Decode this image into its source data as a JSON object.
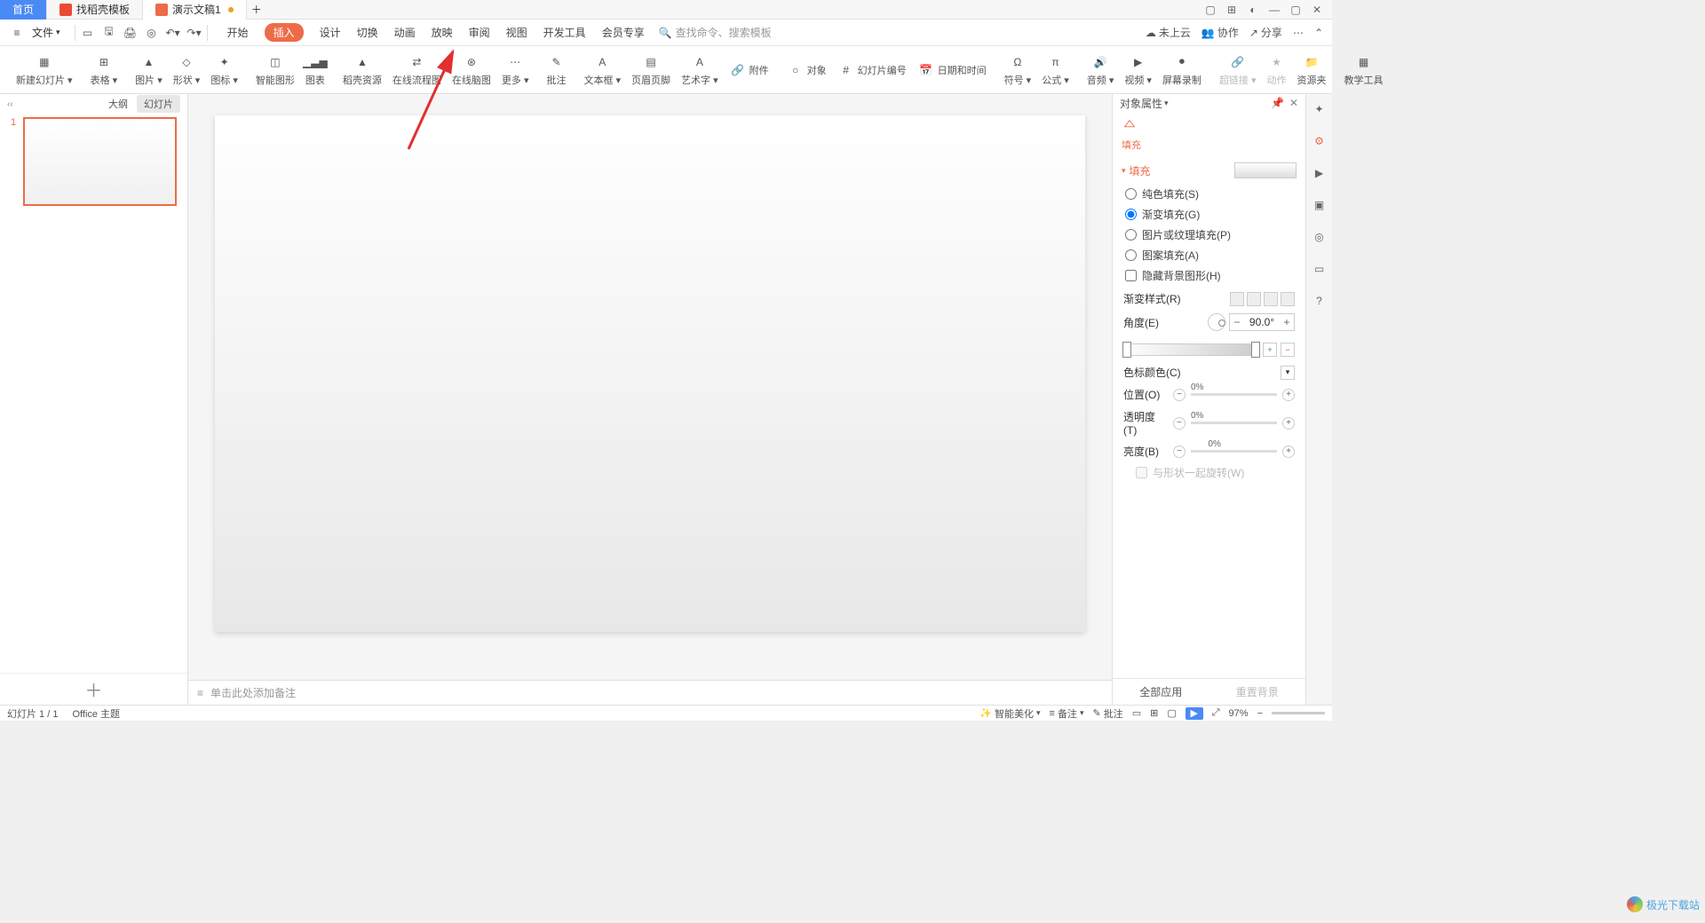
{
  "titlebar": {
    "tabs": [
      {
        "label": "首页",
        "type": "home"
      },
      {
        "label": "找稻壳模板",
        "icon": "red"
      },
      {
        "label": "演示文稿1",
        "icon": "orange",
        "active": true,
        "modified": true
      }
    ]
  },
  "menubar": {
    "file": "文件",
    "tabs": [
      "开始",
      "插入",
      "设计",
      "切换",
      "动画",
      "放映",
      "审阅",
      "视图",
      "开发工具",
      "会员专享"
    ],
    "active_tab": "插入",
    "search_placeholder": "查找命令、搜索模板",
    "right": {
      "cloud": "未上云",
      "collab": "协作",
      "share": "分享"
    }
  },
  "ribbon": [
    {
      "label": "新建幻灯片",
      "dropdown": true
    },
    {
      "sep": true
    },
    {
      "label": "表格",
      "dropdown": true
    },
    {
      "sep": true
    },
    {
      "label": "图片",
      "dropdown": true
    },
    {
      "label": "形状",
      "dropdown": true
    },
    {
      "label": "图标",
      "dropdown": true
    },
    {
      "sep": true
    },
    {
      "label": "智能图形"
    },
    {
      "label": "图表"
    },
    {
      "sep": true
    },
    {
      "label": "稻壳资源"
    },
    {
      "label": "在线流程图"
    },
    {
      "label": "在线脑图"
    },
    {
      "label": "更多",
      "dropdown": true
    },
    {
      "sep": true
    },
    {
      "label": "批注"
    },
    {
      "sep": true
    },
    {
      "label": "文本框",
      "dropdown": true
    },
    {
      "label": "页眉页脚"
    },
    {
      "label": "艺术字",
      "dropdown": true
    },
    {
      "label": "附件",
      "inline": "🔗"
    },
    {
      "sep": true
    },
    {
      "label": "对象",
      "inline": "○"
    },
    {
      "label": "幻灯片编号",
      "inline": "#"
    },
    {
      "label": "日期和时间",
      "inline": "📅"
    },
    {
      "sep": true
    },
    {
      "label": "符号",
      "dropdown": true
    },
    {
      "label": "公式",
      "dropdown": true
    },
    {
      "sep": true
    },
    {
      "label": "音频",
      "dropdown": true
    },
    {
      "label": "视频",
      "dropdown": true
    },
    {
      "label": "屏幕录制"
    },
    {
      "sep": true
    },
    {
      "label": "超链接",
      "dropdown": true,
      "disabled": true
    },
    {
      "label": "动作",
      "disabled": true
    },
    {
      "label": "资源夹"
    },
    {
      "sep": true
    },
    {
      "label": "教学工具"
    }
  ],
  "slidepanel": {
    "tabs": {
      "outline": "大纲",
      "slides": "幻灯片"
    },
    "active": "slides",
    "slides": [
      {
        "num": 1
      }
    ]
  },
  "notes": {
    "placeholder": "单击此处添加备注"
  },
  "props": {
    "title": "对象属性",
    "fill_tab": "填充",
    "section": "填充",
    "options": {
      "solid": "纯色填充(S)",
      "gradient": "渐变填充(G)",
      "picture": "图片或纹理填充(P)",
      "pattern": "图案填充(A)",
      "hidebg": "隐藏背景图形(H)"
    },
    "selected": "gradient",
    "gradient": {
      "style_label": "渐变样式(R)",
      "angle_label": "角度(E)",
      "angle_value": "90.0°",
      "stopcolor_label": "色标颜色(C)",
      "position": {
        "label": "位置(O)",
        "value": "0%"
      },
      "transparency": {
        "label": "透明度(T)",
        "value": "0%"
      },
      "brightness": {
        "label": "亮度(B)",
        "value": "0%"
      },
      "rotate_label": "与形状一起旋转(W)"
    },
    "footer": {
      "all": "全部应用",
      "reset": "重置背景"
    }
  },
  "statusbar": {
    "slide": "幻灯片 1 / 1",
    "theme": "Office 主题",
    "beautify": "智能美化",
    "notes": "备注",
    "comments": "批注",
    "zoom": "97%"
  },
  "watermark": "极光下载站"
}
